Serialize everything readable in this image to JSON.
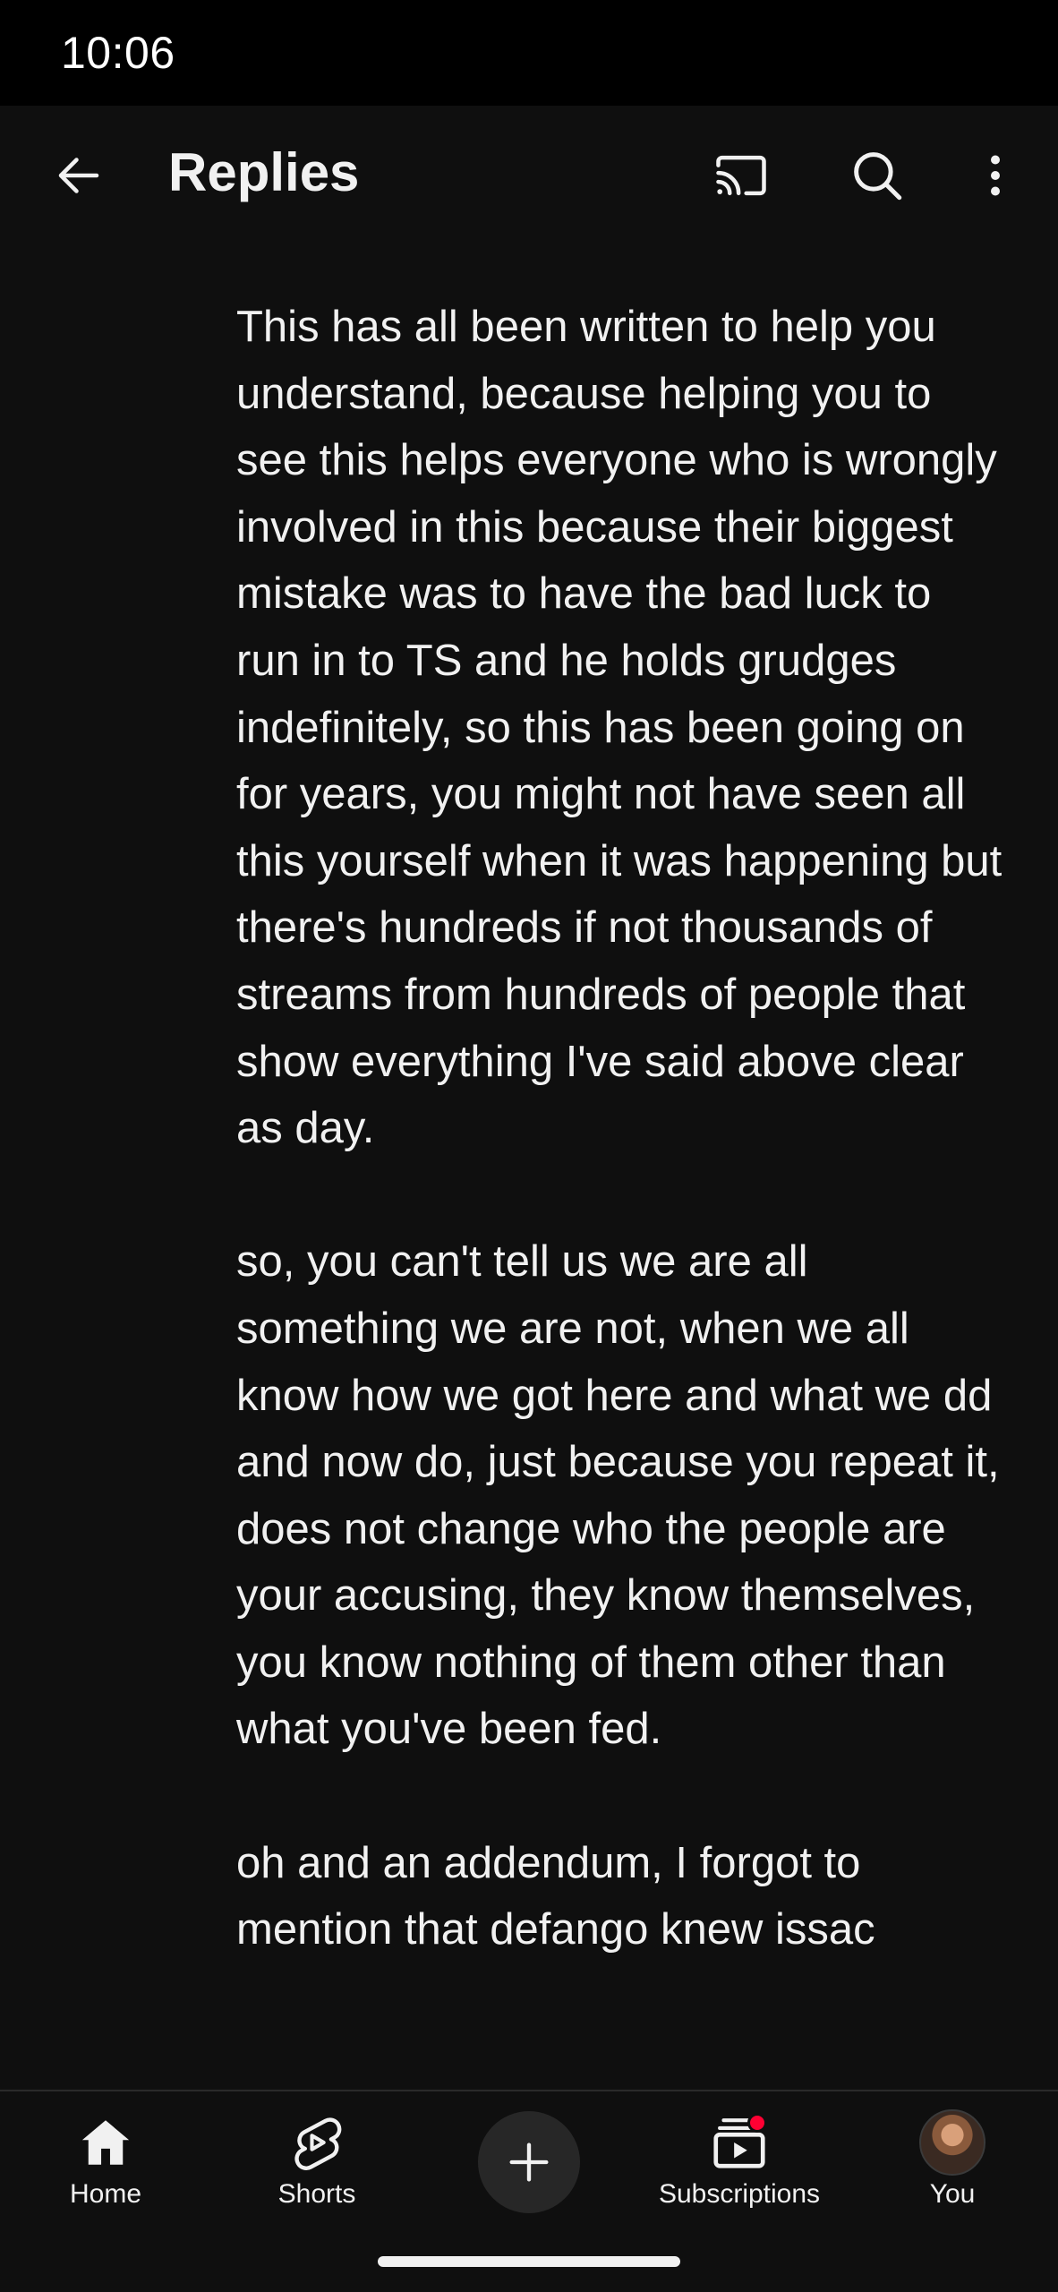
{
  "status_bar": {
    "time": "10:06"
  },
  "app_bar": {
    "title": "Replies",
    "icons": [
      "back-arrow-icon",
      "cast-icon",
      "search-icon",
      "more-vert-icon"
    ]
  },
  "reply": {
    "text": "This has all been written to help you understand, because helping you to see this helps everyone who is wrongly involved in this because their biggest mistake was to have the bad luck to run in to TS and he holds grudges indefinitely, so this has been going on for years, you might not have seen all this yourself when it was happening but there's hundreds if not thousands of streams from hundreds of people that show everything I've said above clear as day.\n\nso, you can't tell us we are all something we are not, when we all know how we got here and what we dd and now do, just because you repeat it, does not change who the people are your accusing, they know themselves, you know nothing of them other than what you've been fed.\n\noh and an addendum, I forgot to mention that defango knew issac"
  },
  "bottom_nav": {
    "home": "Home",
    "shorts": "Shorts",
    "subscriptions": "Subscriptions",
    "you": "You"
  },
  "colors": {
    "background": "#0f0f0f",
    "text": "#f1f1f1",
    "badge": "#ff0033",
    "create_button": "#272727"
  }
}
